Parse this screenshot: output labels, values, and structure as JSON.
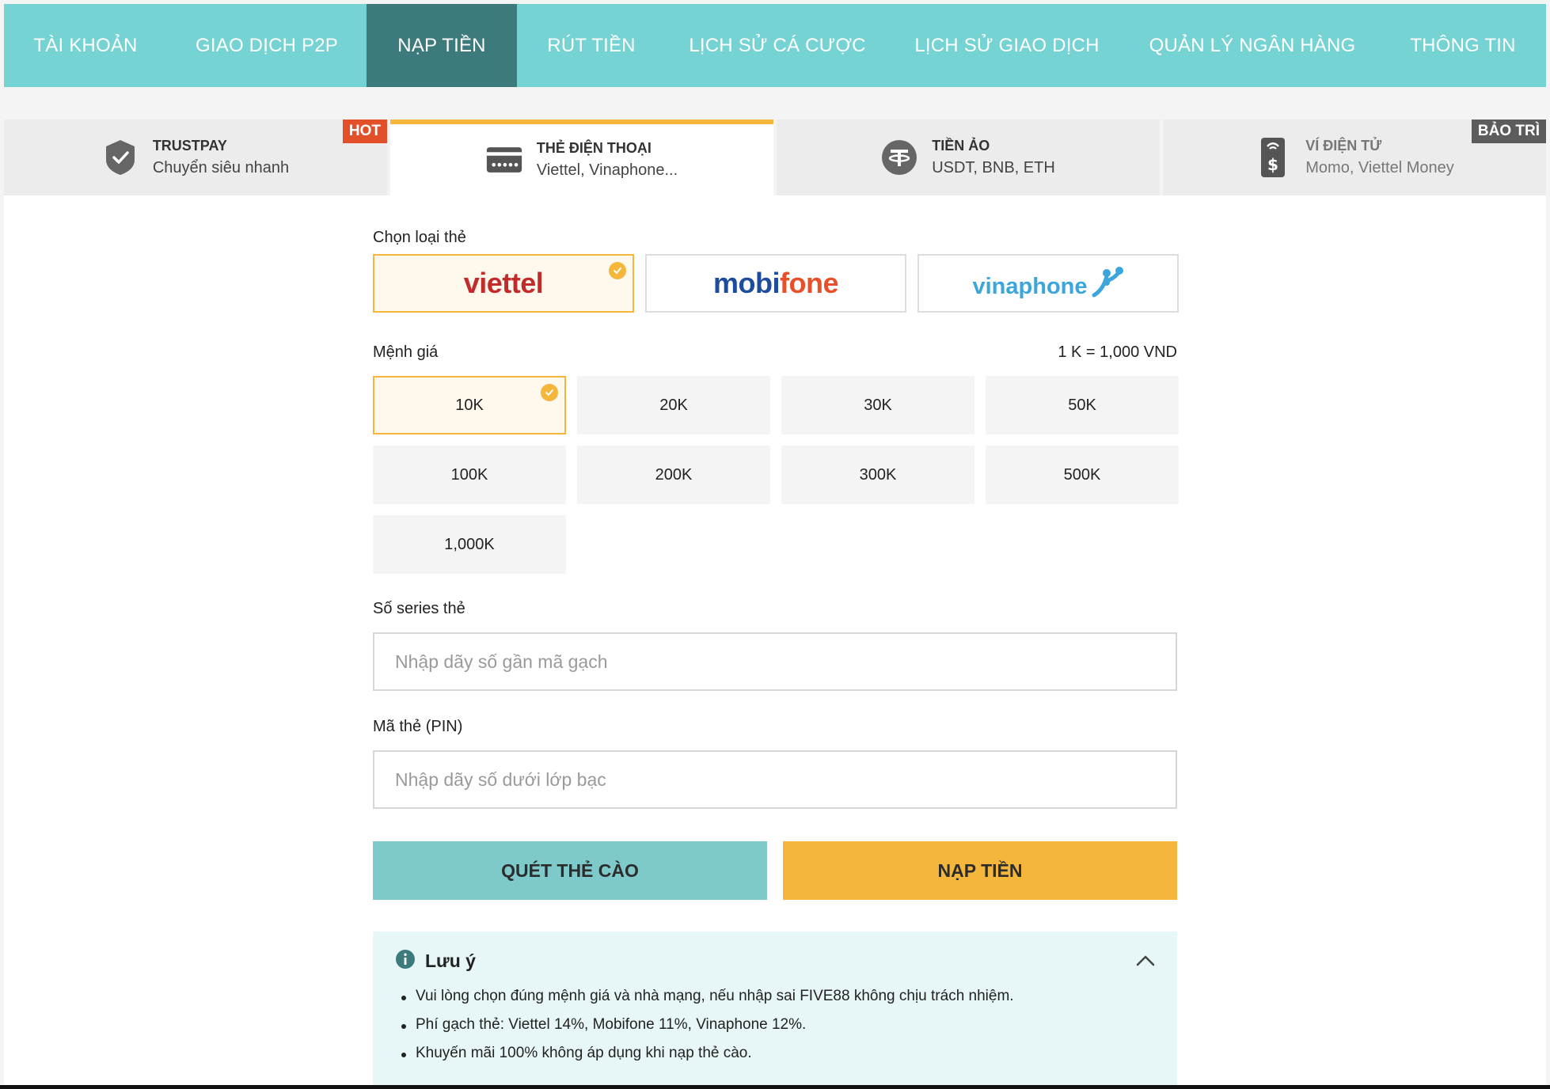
{
  "topnav": {
    "items": [
      {
        "label": "TÀI KHOẢN"
      },
      {
        "label": "GIAO DỊCH P2P"
      },
      {
        "label": "NẠP TIỀN"
      },
      {
        "label": "RÚT TIỀN"
      },
      {
        "label": "LỊCH SỬ CÁ CƯỢC"
      },
      {
        "label": "LỊCH SỬ GIAO DỊCH"
      },
      {
        "label": "QUẢN LÝ NGÂN HÀNG"
      },
      {
        "label": "THÔNG TIN"
      }
    ],
    "active_index": 2,
    "colors": {
      "bar": "#76d3d4",
      "active": "#3c7a7b"
    }
  },
  "methods": [
    {
      "title": "TRUSTPAY",
      "subtitle": "Chuyển siêu nhanh",
      "icon": "shield-check-icon",
      "badge": "HOT"
    },
    {
      "title": "THẺ ĐIỆN THOẠI",
      "subtitle": "Viettel, Vinaphone...",
      "icon": "card-icon",
      "active": true
    },
    {
      "title": "TIỀN ẢO",
      "subtitle": "USDT, BNB, ETH",
      "icon": "tether-icon"
    },
    {
      "title": "VÍ ĐIỆN TỬ",
      "subtitle": "Momo, Viettel Money",
      "icon": "wallet-phone-icon",
      "badge": "BẢO TRÌ"
    }
  ],
  "form": {
    "provider_label": "Chọn loại thẻ",
    "providers": [
      {
        "name": "viettel",
        "selected": true
      },
      {
        "name": "mobifone",
        "logo_a": "mobi",
        "logo_b": "fone"
      },
      {
        "name": "vinaphone"
      }
    ],
    "denom_label": "Mệnh giá",
    "rate": "1 K = 1,000 VND",
    "denominations": [
      "10K",
      "20K",
      "30K",
      "50K",
      "100K",
      "200K",
      "300K",
      "500K",
      "1,000K"
    ],
    "selected_denomination": "10K",
    "serial_label": "Số series thẻ",
    "serial_placeholder": "Nhập dãy số gần mã gạch",
    "serial_value": "",
    "pin_label": "Mã thẻ (PIN)",
    "pin_placeholder": "Nhập dãy số dưới lớp bạc",
    "pin_value": "",
    "scan_button": "QUÉT THẺ CÀO",
    "submit_button": "NẠP TIỀN"
  },
  "note": {
    "title": "Lưu ý",
    "items": [
      "Vui lòng chọn đúng mệnh giá và nhà mạng, nếu nhập sai FIVE88 không chịu trách nhiệm.",
      "Phí gạch thẻ: Viettel 14%, Mobifone 11%, Vinaphone 12%.",
      "Khuyến mãi 100% không áp dụng khi nạp thẻ cào."
    ]
  },
  "colors": {
    "accent": "#f4b73c",
    "hot": "#e2502a",
    "maintenance": "#5c5c5c",
    "scan_button": "#7ecaca"
  }
}
